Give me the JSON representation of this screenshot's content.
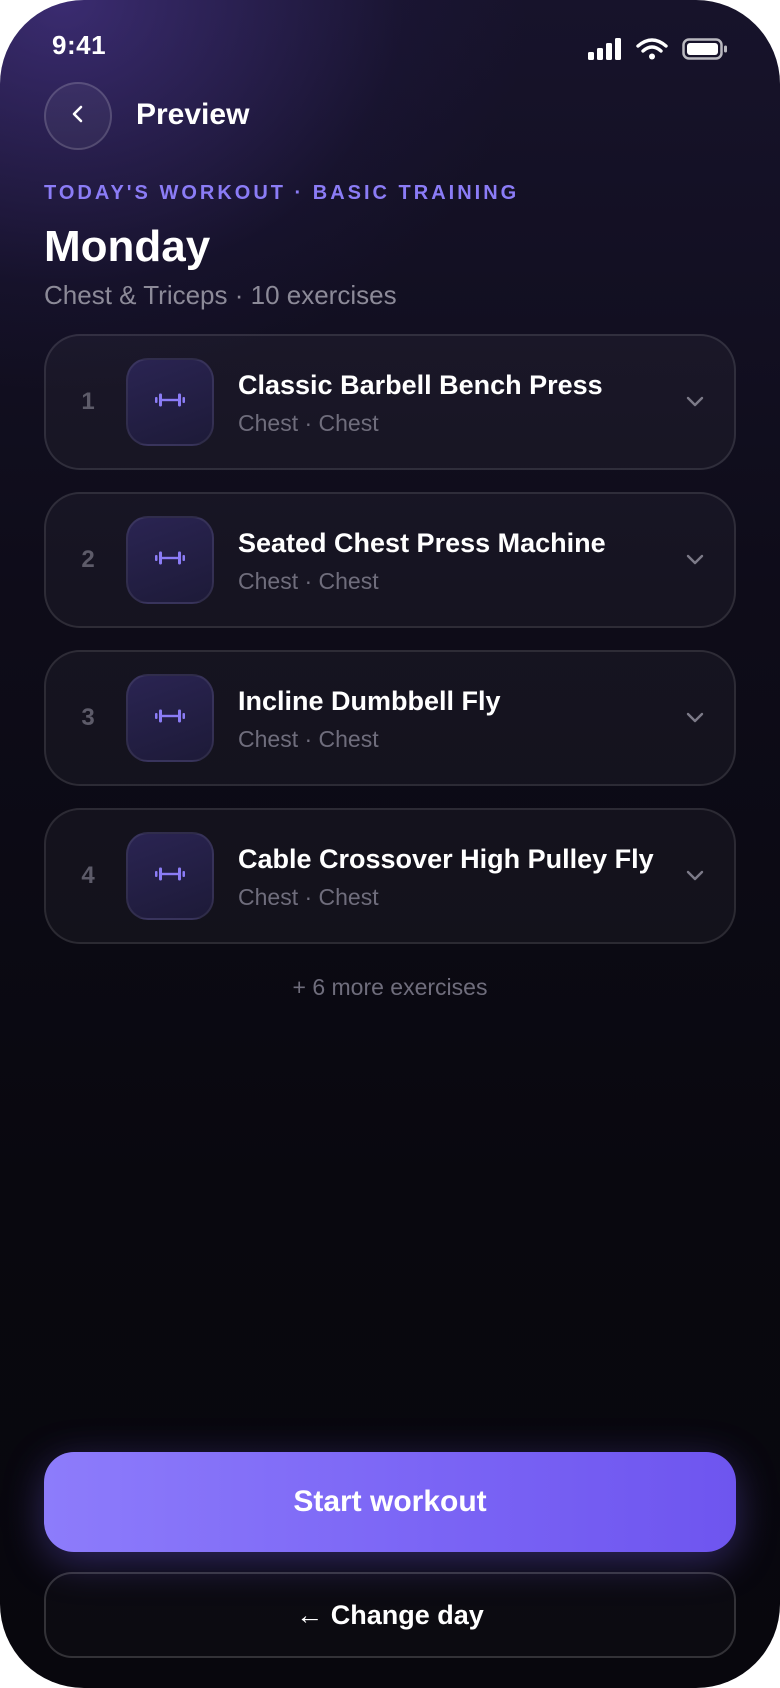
{
  "status_bar": {
    "time": "9:41"
  },
  "header": {
    "title": "Preview"
  },
  "workout": {
    "eyebrow": "TODAY'S WORKOUT · BASIC TRAINING",
    "day": "Monday",
    "subtitle": "Chest & Triceps · 10 exercises"
  },
  "exercises": [
    {
      "number": "1",
      "name": "Classic Barbell Bench Press",
      "meta": "Chest · Chest"
    },
    {
      "number": "2",
      "name": "Seated Chest Press Machine",
      "meta": "Chest · Chest"
    },
    {
      "number": "3",
      "name": "Incline Dumbbell Fly",
      "meta": "Chest · Chest"
    },
    {
      "number": "4",
      "name": "Cable Crossover High Pulley Fly",
      "meta": "Chest · Chest"
    }
  ],
  "more_exercises": "+ 6 more exercises",
  "actions": {
    "start": "Start workout",
    "change_day": "← Change day"
  },
  "colors": {
    "accent": "#8b7cf6",
    "button_gradient_start": "#8d7cfb",
    "button_gradient_end": "#6e55ef",
    "background": "#09080f"
  },
  "icons": {
    "back": "chevron-left-icon",
    "exercise": "dumbbell-icon",
    "expand": "chevron-down-icon"
  }
}
